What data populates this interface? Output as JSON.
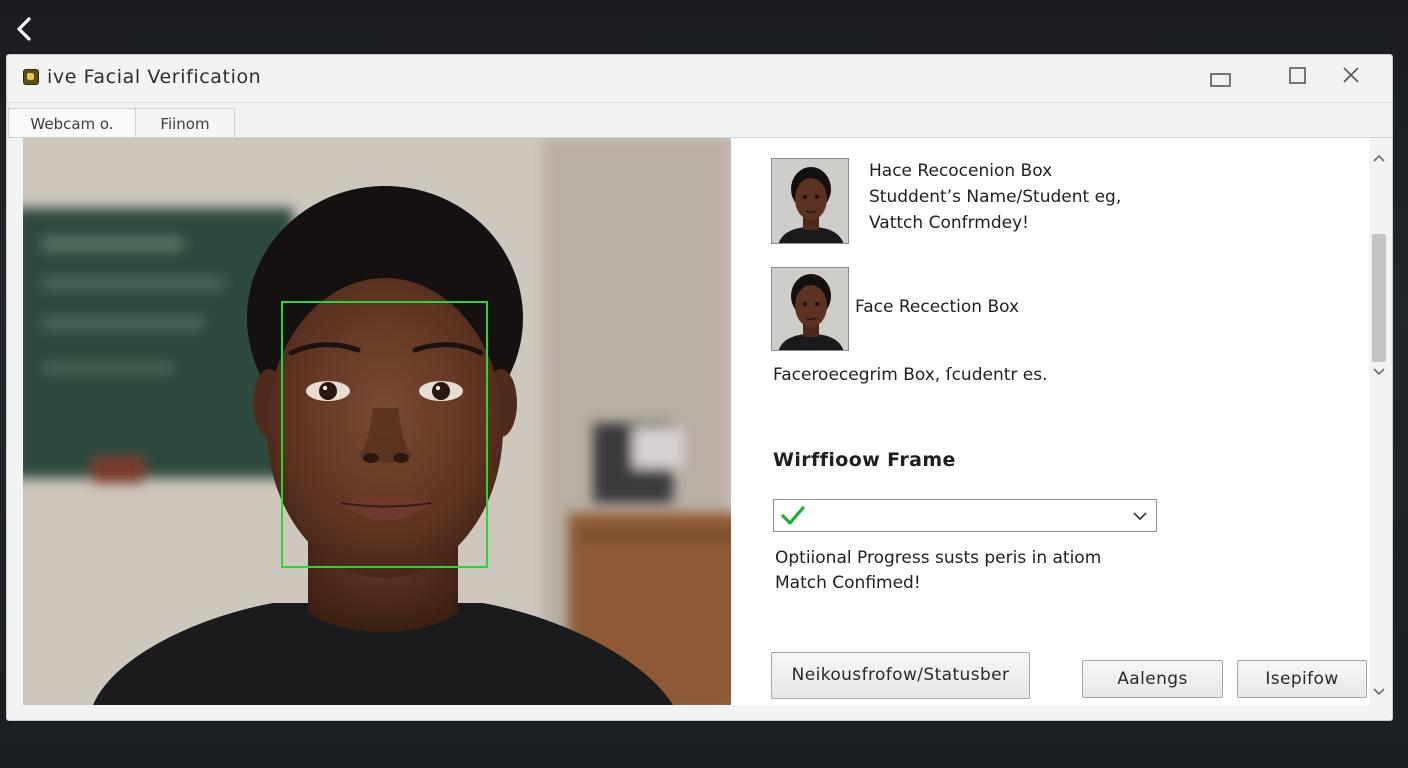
{
  "window": {
    "title": "ive Facial  Verification"
  },
  "tabs": [
    {
      "label": "Webcam  o."
    },
    {
      "label": "Fiinom"
    }
  ],
  "panel": {
    "card1": {
      "line1": "Hace Recocenion Box",
      "line2": "Studdent’s Name/Student eg,",
      "line3": "Vattch Confrmdey!"
    },
    "card2": {
      "label": "Face Recection Box"
    },
    "summary": "Faceroecegrim Box, ſcudentr es.",
    "workflow": {
      "heading": "Wirffioow Frame",
      "status_icon": "check-icon"
    },
    "progress": {
      "line1": "Optiional Progress susts peris in atiom",
      "line2": "Match Confimed!"
    },
    "buttons": {
      "network": "Neikousfrofow/Statusber",
      "cancel": "Aalengs",
      "proceed": "Isepifow"
    }
  },
  "colors": {
    "face_box": "#2fd23a",
    "check": "#1fae2c"
  }
}
